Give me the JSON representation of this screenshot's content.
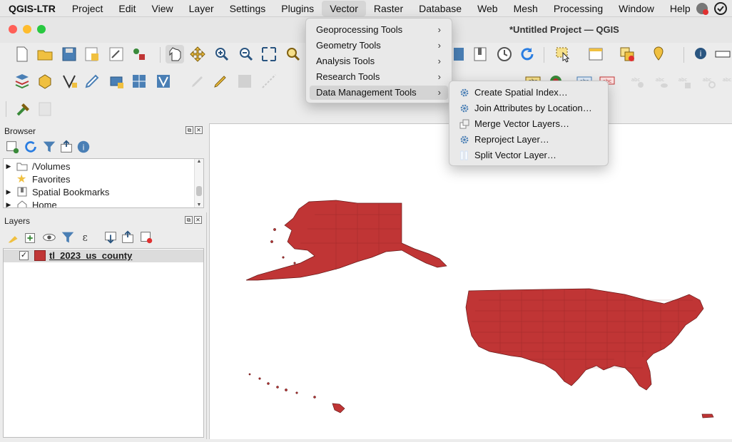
{
  "menubar": {
    "app": "QGIS-LTR",
    "items": [
      "Project",
      "Edit",
      "View",
      "Layer",
      "Settings",
      "Plugins",
      "Vector",
      "Raster",
      "Database",
      "Web",
      "Mesh",
      "Processing",
      "Window",
      "Help"
    ],
    "active": "Vector"
  },
  "window": {
    "title": "*Untitled Project — QGIS"
  },
  "vector_menu": {
    "items": [
      {
        "label": "Geoprocessing Tools"
      },
      {
        "label": "Geometry Tools"
      },
      {
        "label": "Analysis Tools"
      },
      {
        "label": "Research Tools"
      },
      {
        "label": "Data Management Tools"
      }
    ],
    "highlighted": "Data Management Tools"
  },
  "submenu": {
    "items": [
      {
        "label": "Create Spatial Index…",
        "icon": "gear-icon"
      },
      {
        "label": "Join Attributes by Location…",
        "icon": "gear-icon"
      },
      {
        "label": "Merge Vector Layers…",
        "icon": "merge-layers-icon"
      },
      {
        "label": "Reproject Layer…",
        "icon": "gear-icon"
      },
      {
        "label": "Split Vector Layer…",
        "icon": "split-layer-icon"
      }
    ],
    "selected": "Split Vector Layer…"
  },
  "browser": {
    "title": "Browser",
    "items": [
      {
        "label": "/Volumes",
        "icon": "folder-icon",
        "expandable": true
      },
      {
        "label": "Favorites",
        "icon": "star-icon",
        "expandable": false
      },
      {
        "label": "Spatial Bookmarks",
        "icon": "bookmark-icon",
        "expandable": true
      },
      {
        "label": "Home",
        "icon": "home-icon",
        "expandable": true
      }
    ]
  },
  "layers": {
    "title": "Layers",
    "items": [
      {
        "label": "tl_2023_us_county",
        "checked": true,
        "color": "#c03535"
      }
    ]
  },
  "colors": {
    "accent": "#2a7de1",
    "layer_fill": "#c03535"
  }
}
